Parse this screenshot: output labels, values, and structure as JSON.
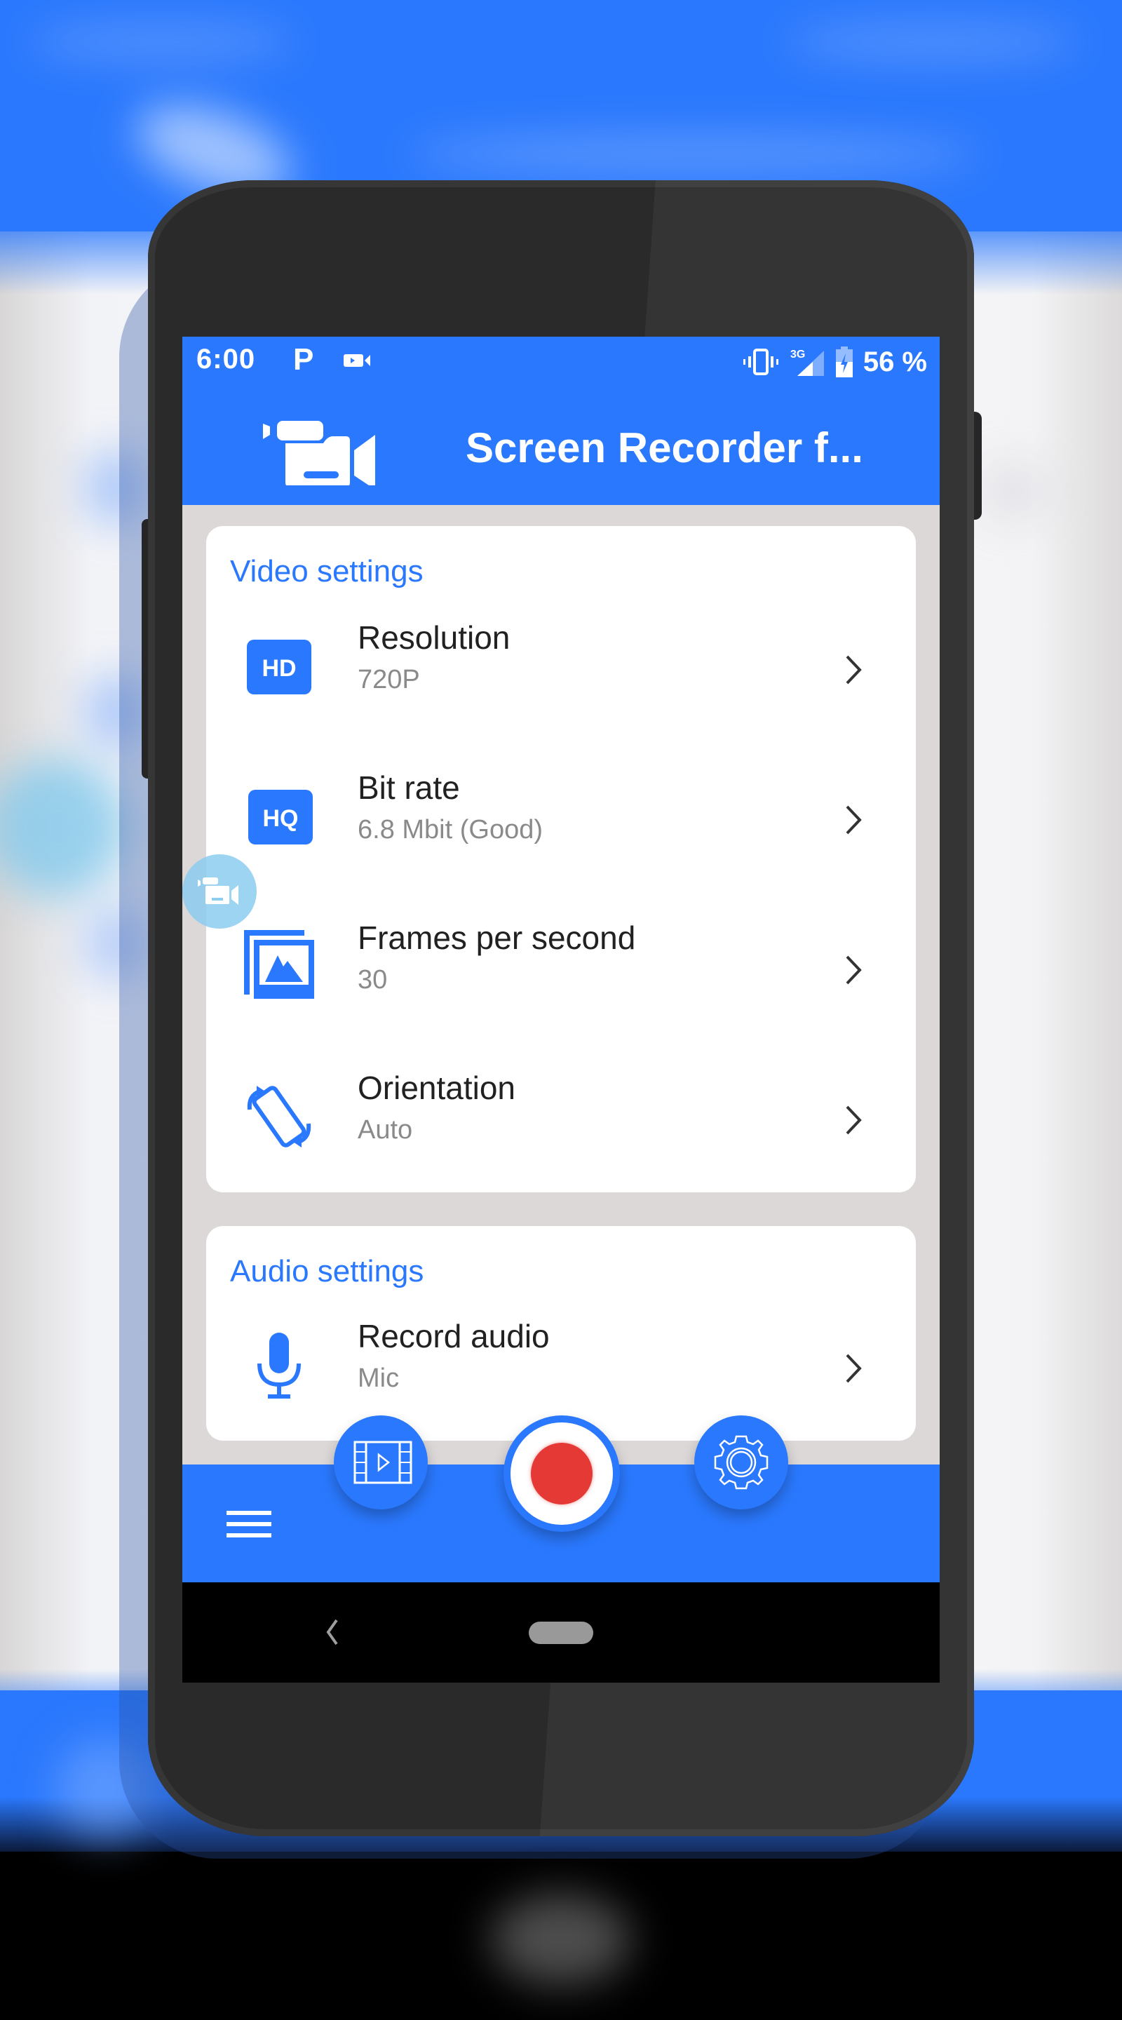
{
  "status_bar": {
    "time": "6:00",
    "notification_icons": [
      "parking-icon",
      "screen-record-icon"
    ],
    "system_icons": [
      "vibrate-icon",
      "signal-3g-icon",
      "battery-charging-icon"
    ],
    "network_type": "3G",
    "battery": "56 %"
  },
  "app_bar": {
    "title": "Screen Recorder f...",
    "logo": "video-camera-icon"
  },
  "video_settings": {
    "header": "Video settings",
    "items": [
      {
        "title": "Resolution",
        "value": "720P",
        "icon": "hd-icon",
        "icon_text": "HD"
      },
      {
        "title": "Bit rate",
        "value": "6.8 Mbit (Good)",
        "icon": "hq-icon",
        "icon_text": "HQ"
      },
      {
        "title": "Frames per second",
        "value": "30",
        "icon": "frames-icon"
      },
      {
        "title": "Orientation",
        "value": "Auto",
        "icon": "screen-rotation-icon"
      }
    ]
  },
  "audio_settings": {
    "header": "Audio settings",
    "items": [
      {
        "title": "Record audio",
        "value": "Mic",
        "icon": "microphone-icon"
      }
    ]
  },
  "bottom_bar": {
    "menu": "menu-icon",
    "buttons": [
      "video-library-icon",
      "record-icon",
      "settings-gear-icon"
    ]
  },
  "nav_bar": {
    "buttons": [
      "back-icon",
      "home-pill"
    ]
  },
  "colors": {
    "primary": "#2a78fd",
    "record": "#e53935",
    "content_background": "#dcd8d8",
    "secondary_text": "#8a8a8a"
  }
}
